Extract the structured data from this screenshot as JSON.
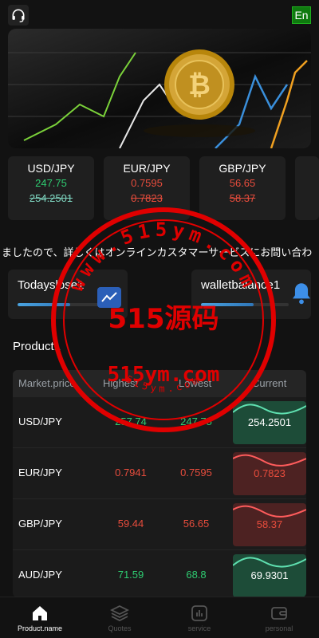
{
  "header": {
    "lang_label": "En"
  },
  "pairs": [
    {
      "name": "USD/JPY",
      "value": "247.75",
      "prev": "254.2501",
      "trend": "up"
    },
    {
      "name": "EUR/JPY",
      "value": "0.7595",
      "prev": "0.7823",
      "trend": "down"
    },
    {
      "name": "GBP/JPY",
      "value": "56.65",
      "prev": "58.37",
      "trend": "down"
    }
  ],
  "ticker": {
    "text": "ましたので、詳しくはオンラインカスタマーサービスにお問い合わ"
  },
  "stats": [
    {
      "label": "Todayslose1",
      "icon": "chart-icon",
      "progress": 0.6
    },
    {
      "label": "walletbalance1",
      "icon": "bell-icon",
      "progress": 0.6
    }
  ],
  "product_section": {
    "title": "Product1",
    "columns": [
      "Market.price",
      "Highest",
      "Lowest",
      "Current"
    ],
    "rows": [
      {
        "name": "USD/JPY",
        "high": "257.74",
        "low": "247.75",
        "current": "254.2501",
        "trend": "up"
      },
      {
        "name": "EUR/JPY",
        "high": "0.7941",
        "low": "0.7595",
        "current": "0.7823",
        "trend": "down"
      },
      {
        "name": "GBP/JPY",
        "high": "59.44",
        "low": "56.65",
        "current": "58.37",
        "trend": "down"
      },
      {
        "name": "AUD/JPY",
        "high": "71.59",
        "low": "68.8",
        "current": "69.9301",
        "trend": "up"
      }
    ]
  },
  "watermark": {
    "main_text": "515源码",
    "site_text": "515ym.com",
    "ring_text_top": "www.515ym.com",
    "ring_text_bottom": "515ym.com"
  },
  "tabbar": {
    "items": [
      {
        "label": "Product.name",
        "icon": "home-icon",
        "active": true
      },
      {
        "label": "Quotes",
        "icon": "layers-icon",
        "active": false
      },
      {
        "label": "service",
        "icon": "service-icon",
        "active": false
      },
      {
        "label": "personal",
        "icon": "wallet-icon",
        "active": false
      }
    ]
  },
  "colors": {
    "background": "#121212",
    "card": "#1f1f1f",
    "up": "#2ecc71",
    "down": "#e74c3c",
    "lang_badge": "#0f7a0f",
    "stamp": "#e00000"
  }
}
